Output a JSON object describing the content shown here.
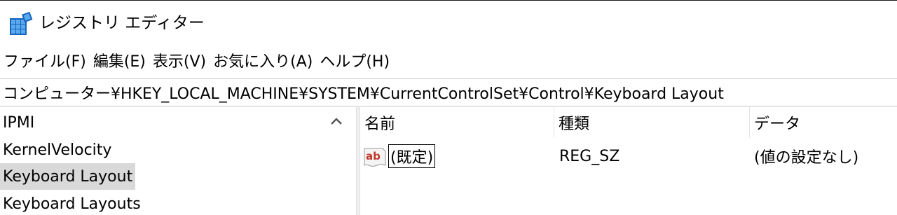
{
  "window": {
    "title": "レジストリ エディター",
    "icon": "registry-icon"
  },
  "menu": [
    {
      "label": "ファイル(F)"
    },
    {
      "label": "編集(E)"
    },
    {
      "label": "表示(V)"
    },
    {
      "label": "お気に入り(A)"
    },
    {
      "label": "ヘルプ(H)"
    }
  ],
  "address": {
    "path": "コンピューター¥HKEY_LOCAL_MACHINE¥SYSTEM¥CurrentControlSet¥Control¥Keyboard Layout"
  },
  "tree": {
    "items": [
      {
        "label": "IPMI",
        "selected": false
      },
      {
        "label": "KernelVelocity",
        "selected": false
      },
      {
        "label": "Keyboard Layout",
        "selected": true
      },
      {
        "label": "Keyboard Layouts",
        "selected": false
      }
    ]
  },
  "list": {
    "columns": [
      {
        "label": "名前"
      },
      {
        "label": "種類"
      },
      {
        "label": "データ"
      }
    ],
    "rows": [
      {
        "name": "(既定)",
        "type": "REG_SZ",
        "data": "(値の設定なし)",
        "icon": "string-value-icon"
      }
    ]
  },
  "colors": {
    "selection": "#d9d9d9",
    "icon_blue": "#1e6fc8",
    "value_icon_red": "#c0392b"
  }
}
